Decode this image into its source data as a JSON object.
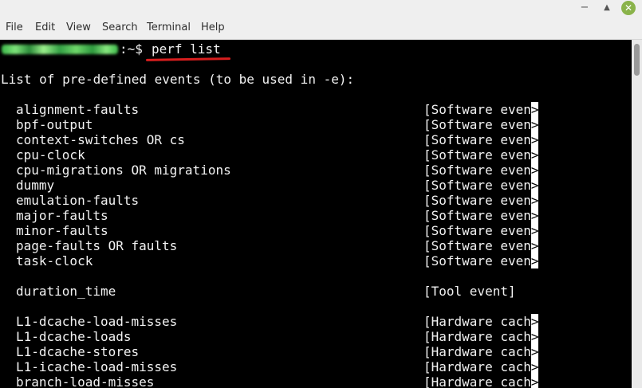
{
  "menu": [
    "File",
    "Edit",
    "View",
    "Search",
    "Terminal",
    "Help"
  ],
  "window_buttons": {
    "minimize": "−",
    "maximize": "▲",
    "close": "✕"
  },
  "prompt": {
    "suffix": ":~$",
    "command": "perf list"
  },
  "header_line": "List of pre-defined events (to be used in -e):",
  "truncation_glyph": ">",
  "software_events": [
    {
      "name": "alignment-faults",
      "type": "[Software even"
    },
    {
      "name": "bpf-output",
      "type": "[Software even"
    },
    {
      "name": "context-switches OR cs",
      "type": "[Software even"
    },
    {
      "name": "cpu-clock",
      "type": "[Software even"
    },
    {
      "name": "cpu-migrations OR migrations",
      "type": "[Software even"
    },
    {
      "name": "dummy",
      "type": "[Software even"
    },
    {
      "name": "emulation-faults",
      "type": "[Software even"
    },
    {
      "name": "major-faults",
      "type": "[Software even"
    },
    {
      "name": "minor-faults",
      "type": "[Software even"
    },
    {
      "name": "page-faults OR faults",
      "type": "[Software even"
    },
    {
      "name": "task-clock",
      "type": "[Software even"
    }
  ],
  "tool_event": {
    "name": "duration_time",
    "type": "[Tool event]"
  },
  "hardware_events": [
    {
      "name": "L1-dcache-load-misses",
      "type": "[Hardware cach"
    },
    {
      "name": "L1-dcache-loads",
      "type": "[Hardware cach"
    },
    {
      "name": "L1-dcache-stores",
      "type": "[Hardware cach"
    },
    {
      "name": "L1-icache-load-misses",
      "type": "[Hardware cach"
    },
    {
      "name": "branch-load-misses",
      "type": "[Hardware cach"
    }
  ],
  "colors": {
    "underline": "#d81e1e",
    "close_button": "#8ab34a",
    "terminal_bg": "#000000",
    "terminal_fg": "#f2f2f2"
  }
}
